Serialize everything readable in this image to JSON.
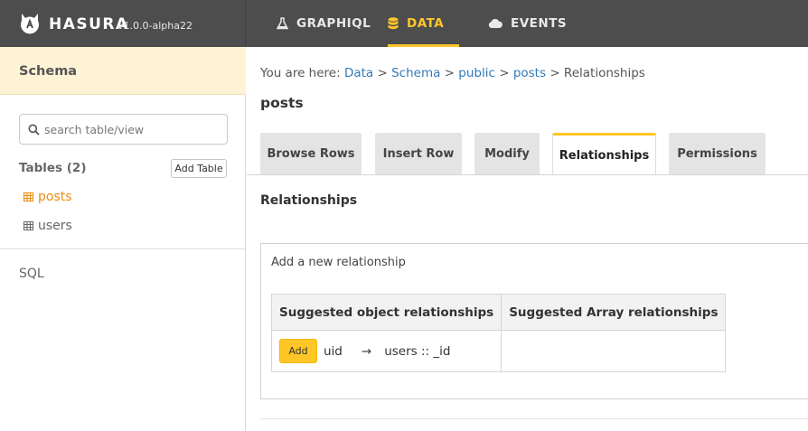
{
  "brand": {
    "name": "HASURA",
    "version": "v1.0.0-alpha22"
  },
  "nav": {
    "tabs": [
      {
        "label": "GRAPHIQL",
        "icon": "flask-icon"
      },
      {
        "label": "DATA",
        "icon": "database-icon",
        "active": true
      },
      {
        "label": "EVENTS",
        "icon": "cloud-icon"
      }
    ]
  },
  "sidebar": {
    "schema_label": "Schema",
    "search_placeholder": "search table/view",
    "tables_title": "Tables (2)",
    "add_table_label": "Add Table",
    "tables": [
      {
        "name": "posts",
        "active": true
      },
      {
        "name": "users",
        "active": false
      }
    ],
    "sql_label": "SQL"
  },
  "breadcrumb": {
    "prefix": "You are here:",
    "items": [
      "Data",
      "Schema",
      "public",
      "posts",
      "Relationships"
    ],
    "separator": ">"
  },
  "page_title": "posts",
  "tabs": [
    {
      "label": "Browse Rows"
    },
    {
      "label": "Insert Row"
    },
    {
      "label": "Modify"
    },
    {
      "label": "Relationships",
      "active": true
    },
    {
      "label": "Permissions"
    }
  ],
  "section_title": "Relationships",
  "relationship_box": {
    "title": "Add a new relationship",
    "headers": [
      "Suggested object relationships",
      "Suggested Array relationships"
    ],
    "rows": [
      {
        "add_label": "Add",
        "from": "uid",
        "arrow": "→",
        "to": "users :: _id",
        "array": ""
      }
    ]
  },
  "colors": {
    "accent": "#ffc627",
    "nav_bg": "#4d4d4d",
    "active_table": "#f18a12",
    "link": "#337ab7"
  }
}
